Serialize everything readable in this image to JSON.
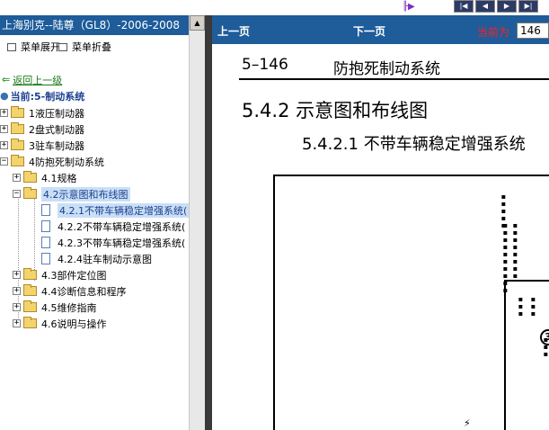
{
  "window": {
    "title": "上海别克--陆尊（GL8）-2006-2008"
  },
  "menu": {
    "expand_label": "菜单展开",
    "collapse_label": "菜单折叠"
  },
  "tree": {
    "back_label": "返回上一级",
    "current_label": "当前:5-制动系统",
    "items": [
      {
        "label": "1液压制动器"
      },
      {
        "label": "2盘式制动器"
      },
      {
        "label": "3驻车制动器"
      },
      {
        "label": "4防抱死制动系统"
      },
      {
        "label": "4.1规格"
      },
      {
        "label": "4.2示意图和布线图"
      },
      {
        "label": "4.2.1不带车辆稳定增强系统("
      },
      {
        "label": "4.2.2不带车辆稳定增强系统("
      },
      {
        "label": "4.2.3不带车辆稳定增强系统("
      },
      {
        "label": "4.2.4驻车制动示意图"
      },
      {
        "label": "4.3部件定位图"
      },
      {
        "label": "4.4诊断信息和程序"
      },
      {
        "label": "4.5维修指南"
      },
      {
        "label": "4.6说明与操作"
      }
    ]
  },
  "nav": {
    "prev_label": "上一页",
    "next_label": "下一页",
    "current_label": "当前为",
    "page_value": "146"
  },
  "document": {
    "page_number": "5–146",
    "header_title": "防抱死制动系统",
    "section_title": "5.4.2 示意图和布线图",
    "subsection_title": "5.4.2.1 不带车辆稳定增强系统"
  },
  "colors": {
    "header_blue": "#1e5c9a",
    "selection": "#c9dff6",
    "alert_red": "#ff2020"
  },
  "icons": {
    "back": "back-arrow-icon",
    "folder": "folder-icon",
    "document": "document-icon"
  }
}
